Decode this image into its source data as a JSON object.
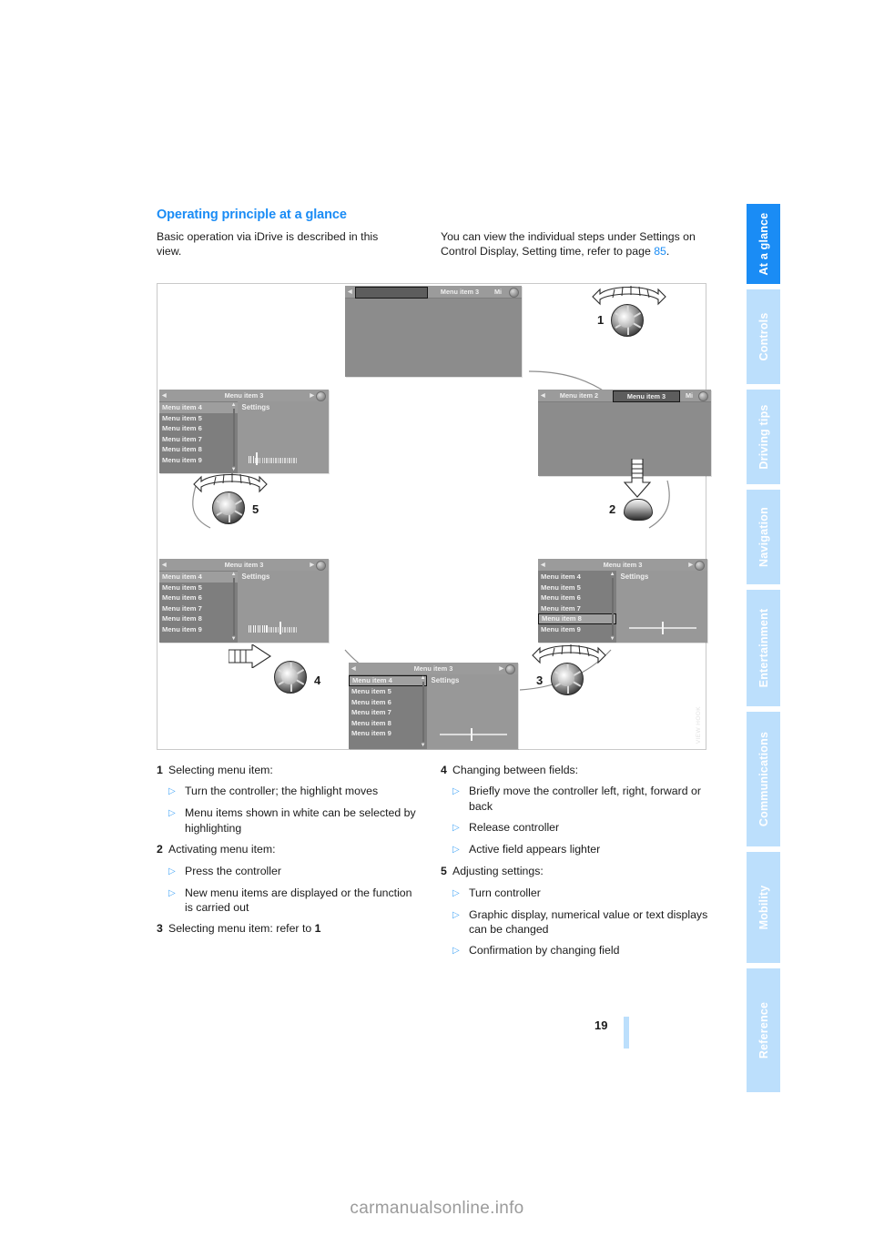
{
  "document": {
    "page_number": "19",
    "watermark": "carmanualsonline.info",
    "figure_code": "VIEW HOOK"
  },
  "heading": "Operating principle at a glance",
  "intro": {
    "left": "Basic operation via iDrive is described in this view.",
    "right_before": "You can view the individual steps under Settings on Control Display, Setting time, refer to page ",
    "right_link": "85",
    "right_after": "."
  },
  "sidebar": {
    "tabs": [
      {
        "label": "At a glance",
        "active": true
      },
      {
        "label": "Controls",
        "active": false
      },
      {
        "label": "Driving tips",
        "active": false
      },
      {
        "label": "Navigation",
        "active": false
      },
      {
        "label": "Entertainment",
        "active": false
      },
      {
        "label": "Communications",
        "active": false
      },
      {
        "label": "Mobility",
        "active": false
      },
      {
        "label": "Reference",
        "active": false
      }
    ],
    "accent_active": "#1a8cf5",
    "accent_inactive": "#bcdffc"
  },
  "figure": {
    "menu_items": [
      "Menu item 4",
      "Menu item 5",
      "Menu item 6",
      "Menu item 7",
      "Menu item 8",
      "Menu item 9"
    ],
    "settings_caption": "Settings",
    "panels": {
      "top_center": {
        "bar_blank": "",
        "bar_item_a": "Menu item 3",
        "bar_item_b": "Mi"
      },
      "right_upper": {
        "bar_item_a": "Menu item 2",
        "bar_item_b": "Menu item 3",
        "bar_item_c": "Mi"
      },
      "left_upper": {
        "title": "Menu item 3",
        "highlight": "Menu item 4"
      },
      "left_lower": {
        "title": "Menu item 3",
        "highlight": "Menu item 4"
      },
      "right_lower": {
        "title": "Menu item 3",
        "highlight": "Menu item 8"
      },
      "bottom_center": {
        "title": "Menu item 3",
        "highlight": "Menu item 4"
      }
    },
    "callouts": [
      "1",
      "2",
      "3",
      "4",
      "5"
    ]
  },
  "steps_left": [
    {
      "number": "1",
      "title": "Selecting menu item:",
      "bullets": [
        "Turn the controller; the highlight moves",
        "Menu items shown in white can be selected by highlighting"
      ]
    },
    {
      "number": "2",
      "title": "Activating menu item:",
      "bullets": [
        "Press the controller",
        "New menu items are displayed or the function is carried out"
      ]
    },
    {
      "number": "3",
      "title": "Selecting menu item: refer to 1",
      "bullets": []
    }
  ],
  "steps_right": [
    {
      "number": "4",
      "title": "Changing between fields:",
      "bullets": [
        "Briefly move the controller left, right, forward or back",
        "Release controller",
        "Active field appears lighter"
      ]
    },
    {
      "number": "5",
      "title": "Adjusting settings:",
      "bullets": [
        "Turn controller",
        "Graphic display, numerical value or text displays can be changed",
        "Confirmation by changing field"
      ]
    }
  ]
}
